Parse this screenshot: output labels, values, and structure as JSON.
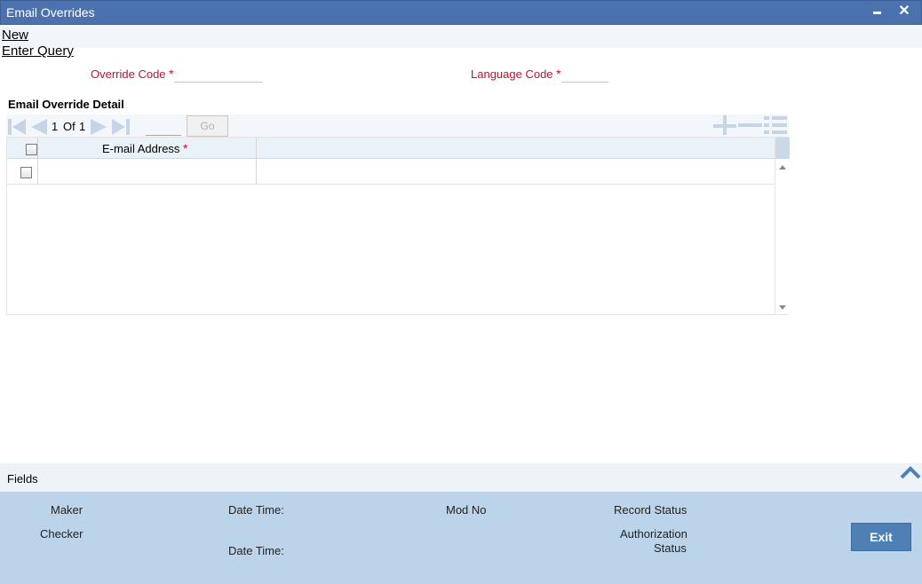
{
  "window": {
    "title": "Email Overrides",
    "close_glyph": "✕"
  },
  "actions": {
    "new_label": "New",
    "enter_query_label": "Enter Query"
  },
  "form": {
    "override_code_label": "Override Code",
    "language_code_label": "Language Code",
    "required_mark": "*",
    "override_code_value": "",
    "language_code_value": ""
  },
  "detail": {
    "section_title": "Email Override Detail",
    "pager": {
      "current": "1",
      "of_label": "Of",
      "total": "1"
    },
    "goto_value": "",
    "go_label": "Go",
    "columns": [
      {
        "label": "E-mail Address",
        "required": true
      }
    ],
    "rows": [
      {
        "email": ""
      }
    ]
  },
  "fields_bar": {
    "label": "Fields"
  },
  "footer": {
    "maker_label": "Maker",
    "checker_label": "Checker",
    "date_time_label": "Date Time:",
    "mod_no_label": "Mod No",
    "record_status_label": "Record Status",
    "authorization_label": "Authorization",
    "status_label": "Status",
    "exit_label": "Exit"
  },
  "icons": {
    "first": "first-page-icon",
    "prev": "previous-page-icon",
    "next": "next-page-icon",
    "last": "last-page-icon",
    "add": "add-row-icon",
    "delete": "delete-row-icon",
    "view": "single-view-icon",
    "collapse": "chevron-up-icon"
  },
  "colors": {
    "title_bar": "#4b72ae",
    "required_red": "#c8102e",
    "footer_bg": "#bcd4e9",
    "exit_button": "#4e80b6"
  }
}
